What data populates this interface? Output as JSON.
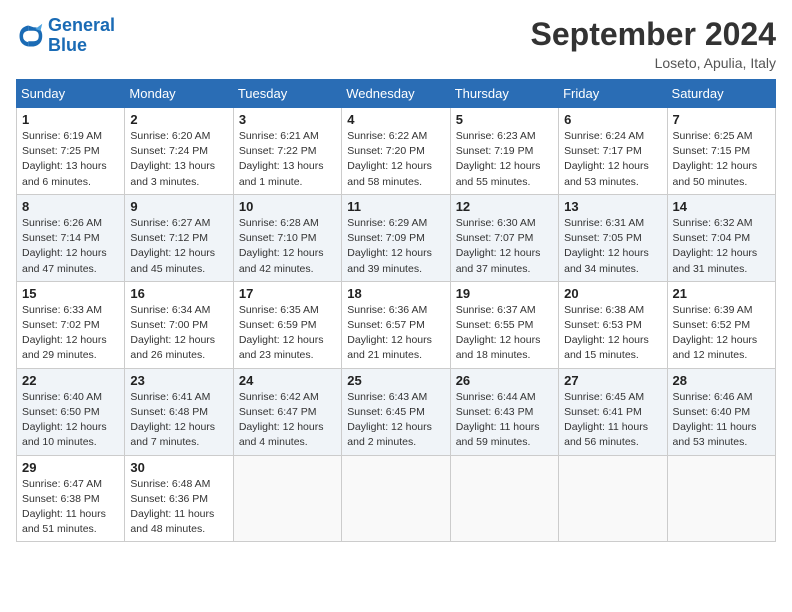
{
  "header": {
    "logo_line1": "General",
    "logo_line2": "Blue",
    "month_title": "September 2024",
    "location": "Loseto, Apulia, Italy"
  },
  "weekdays": [
    "Sunday",
    "Monday",
    "Tuesday",
    "Wednesday",
    "Thursday",
    "Friday",
    "Saturday"
  ],
  "weeks": [
    [
      {
        "day": "1",
        "info": "Sunrise: 6:19 AM\nSunset: 7:25 PM\nDaylight: 13 hours\nand 6 minutes."
      },
      {
        "day": "2",
        "info": "Sunrise: 6:20 AM\nSunset: 7:24 PM\nDaylight: 13 hours\nand 3 minutes."
      },
      {
        "day": "3",
        "info": "Sunrise: 6:21 AM\nSunset: 7:22 PM\nDaylight: 13 hours\nand 1 minute."
      },
      {
        "day": "4",
        "info": "Sunrise: 6:22 AM\nSunset: 7:20 PM\nDaylight: 12 hours\nand 58 minutes."
      },
      {
        "day": "5",
        "info": "Sunrise: 6:23 AM\nSunset: 7:19 PM\nDaylight: 12 hours\nand 55 minutes."
      },
      {
        "day": "6",
        "info": "Sunrise: 6:24 AM\nSunset: 7:17 PM\nDaylight: 12 hours\nand 53 minutes."
      },
      {
        "day": "7",
        "info": "Sunrise: 6:25 AM\nSunset: 7:15 PM\nDaylight: 12 hours\nand 50 minutes."
      }
    ],
    [
      {
        "day": "8",
        "info": "Sunrise: 6:26 AM\nSunset: 7:14 PM\nDaylight: 12 hours\nand 47 minutes."
      },
      {
        "day": "9",
        "info": "Sunrise: 6:27 AM\nSunset: 7:12 PM\nDaylight: 12 hours\nand 45 minutes."
      },
      {
        "day": "10",
        "info": "Sunrise: 6:28 AM\nSunset: 7:10 PM\nDaylight: 12 hours\nand 42 minutes."
      },
      {
        "day": "11",
        "info": "Sunrise: 6:29 AM\nSunset: 7:09 PM\nDaylight: 12 hours\nand 39 minutes."
      },
      {
        "day": "12",
        "info": "Sunrise: 6:30 AM\nSunset: 7:07 PM\nDaylight: 12 hours\nand 37 minutes."
      },
      {
        "day": "13",
        "info": "Sunrise: 6:31 AM\nSunset: 7:05 PM\nDaylight: 12 hours\nand 34 minutes."
      },
      {
        "day": "14",
        "info": "Sunrise: 6:32 AM\nSunset: 7:04 PM\nDaylight: 12 hours\nand 31 minutes."
      }
    ],
    [
      {
        "day": "15",
        "info": "Sunrise: 6:33 AM\nSunset: 7:02 PM\nDaylight: 12 hours\nand 29 minutes."
      },
      {
        "day": "16",
        "info": "Sunrise: 6:34 AM\nSunset: 7:00 PM\nDaylight: 12 hours\nand 26 minutes."
      },
      {
        "day": "17",
        "info": "Sunrise: 6:35 AM\nSunset: 6:59 PM\nDaylight: 12 hours\nand 23 minutes."
      },
      {
        "day": "18",
        "info": "Sunrise: 6:36 AM\nSunset: 6:57 PM\nDaylight: 12 hours\nand 21 minutes."
      },
      {
        "day": "19",
        "info": "Sunrise: 6:37 AM\nSunset: 6:55 PM\nDaylight: 12 hours\nand 18 minutes."
      },
      {
        "day": "20",
        "info": "Sunrise: 6:38 AM\nSunset: 6:53 PM\nDaylight: 12 hours\nand 15 minutes."
      },
      {
        "day": "21",
        "info": "Sunrise: 6:39 AM\nSunset: 6:52 PM\nDaylight: 12 hours\nand 12 minutes."
      }
    ],
    [
      {
        "day": "22",
        "info": "Sunrise: 6:40 AM\nSunset: 6:50 PM\nDaylight: 12 hours\nand 10 minutes."
      },
      {
        "day": "23",
        "info": "Sunrise: 6:41 AM\nSunset: 6:48 PM\nDaylight: 12 hours\nand 7 minutes."
      },
      {
        "day": "24",
        "info": "Sunrise: 6:42 AM\nSunset: 6:47 PM\nDaylight: 12 hours\nand 4 minutes."
      },
      {
        "day": "25",
        "info": "Sunrise: 6:43 AM\nSunset: 6:45 PM\nDaylight: 12 hours\nand 2 minutes."
      },
      {
        "day": "26",
        "info": "Sunrise: 6:44 AM\nSunset: 6:43 PM\nDaylight: 11 hours\nand 59 minutes."
      },
      {
        "day": "27",
        "info": "Sunrise: 6:45 AM\nSunset: 6:41 PM\nDaylight: 11 hours\nand 56 minutes."
      },
      {
        "day": "28",
        "info": "Sunrise: 6:46 AM\nSunset: 6:40 PM\nDaylight: 11 hours\nand 53 minutes."
      }
    ],
    [
      {
        "day": "29",
        "info": "Sunrise: 6:47 AM\nSunset: 6:38 PM\nDaylight: 11 hours\nand 51 minutes."
      },
      {
        "day": "30",
        "info": "Sunrise: 6:48 AM\nSunset: 6:36 PM\nDaylight: 11 hours\nand 48 minutes."
      },
      null,
      null,
      null,
      null,
      null
    ]
  ]
}
